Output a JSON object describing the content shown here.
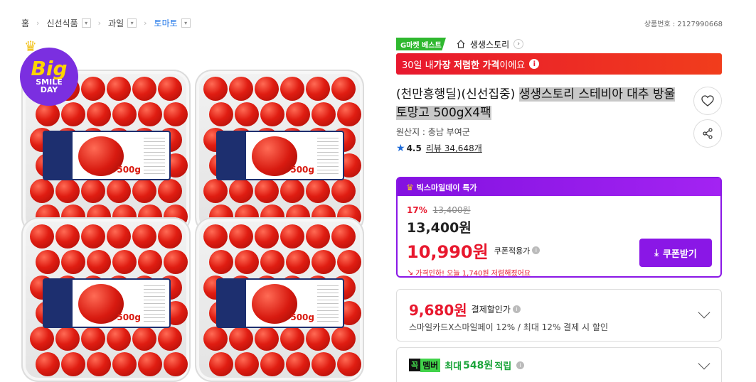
{
  "breadcrumb": {
    "home": "홈",
    "level1": "신선식품",
    "level2": "과일",
    "level3": "토마토"
  },
  "product_no": "상품번호 : 2127990668",
  "gallery": {
    "badge_big": "Big",
    "badge_line1": "SMILE",
    "badge_line2": "DAY",
    "label_weight": "500g",
    "image_alt": "product-photo"
  },
  "seller": {
    "badge": "G마켓 베스트",
    "store_name": "생생스토리"
  },
  "promo": {
    "prefix": "30일 내 ",
    "bold": "가장 저렴한 가격",
    "suffix": "이에요"
  },
  "title": {
    "plain": "(천만흥행딜)(신선집중) ",
    "highlight": "생생스토리 스테비아 대추 방울 토망고 500gX4팩"
  },
  "origin": "원산지 : 충남 부여군",
  "rating": {
    "score": "4.5",
    "reviews": "리뷰 34,648개"
  },
  "coupon": {
    "header": "빅스마일데이 특가",
    "discount_pct": "17%",
    "old_price": "13,400원",
    "price": "13,400원",
    "coupon_price": "10,990원",
    "coupon_label": "쿠폰적용가",
    "lowest_note": "가격인하! 오늘 1,740원 저렴해졌어요",
    "button": "쿠폰받기"
  },
  "payment": {
    "price": "9,680원",
    "label": "결제할인가",
    "desc": "스마일카드X스마일페이 12% / 최대 12% 결제 시 할인"
  },
  "member": {
    "ggok": "꼭",
    "word": "멤버",
    "prefix": "최대",
    "amount": "548원",
    "suffix": "적립"
  },
  "colors": {
    "purple": "#8a17e6",
    "red": "#e8182e",
    "green": "#2fb82f"
  }
}
